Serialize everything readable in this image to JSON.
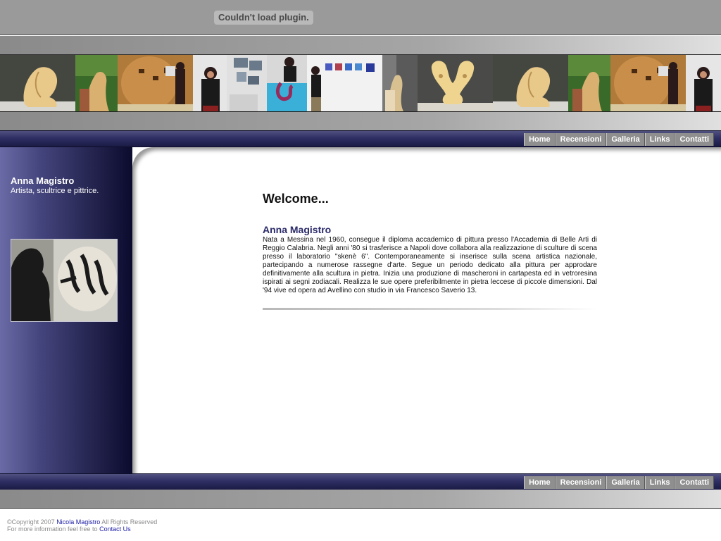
{
  "plugin": {
    "message": "Couldn't load plugin."
  },
  "nav": {
    "items": [
      "Home",
      "Recensioni",
      "Galleria",
      "Links",
      "Contatti"
    ]
  },
  "sidebar": {
    "name": "Anna Magistro",
    "subtitle": "Artista, scultrice e pittrice."
  },
  "main": {
    "welcome": "Welcome...",
    "article_title": "Anna Magistro",
    "article_body": "Nata a Messina nel 1960, consegue il diploma accademico di pittura presso l'Accademia di Belle Arti di Reggio Calabria. Negli anni '80 si trasferisce a Napoli dove collabora alla realizzazione di sculture di scena presso il laboratorio \"skenè 6\". Contemporaneamente si inserisce sulla scena artistica nazionale, partecipando a numerose rassegne d'arte. Segue un periodo dedicato alla pittura per approdare definitivamente alla scultura in pietra. Inizia una produzione di mascheroni in cartapesta ed in vetroresina ispirati ai segni zodiacali. Realizza le sue opere preferibilmente in pietra leccese di piccole dimensioni. Dal '94 vive ed opera ad Avellino con studio in via Francesco Saverio 13."
  },
  "footer": {
    "copyright_prefix": "©Copyright 2007",
    "author_link": "Nicola Magistro",
    "rights": "All Rights Reserved",
    "info_text": "For more information feel free to",
    "contact_link": "Contact Us"
  },
  "colors": {
    "nav_dark": "#2f2f64",
    "sidebar_dark": "#0b0b2e",
    "accent_title": "#2a2a6a",
    "link": "#1a1aa6"
  },
  "photos": [
    "sculpture-head-image",
    "sculpture-garden-image",
    "cave-exhibition-image",
    "artist-portrait-image",
    "wall-art-exhibit-image",
    "blue-sculpture-image",
    "gallery-room-image",
    "mirror-sculpture-image",
    "double-face-sculpture-image",
    "sculpture-head-image",
    "sculpture-garden-image",
    "cave-exhibition-image",
    "artist-portrait-image"
  ]
}
